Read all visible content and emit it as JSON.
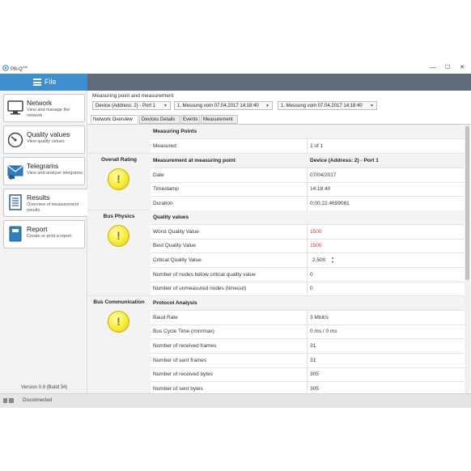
{
  "app": {
    "title": "PB-Q",
    "title_sup": "one"
  },
  "window_controls": {
    "minimize": "—",
    "maximize": "☐",
    "close": "✕"
  },
  "file_menu": {
    "label": "File"
  },
  "nav": [
    {
      "title": "Network",
      "desc": "View and manage the network",
      "icon": "network-monitor-icon"
    },
    {
      "title": "Quality values",
      "desc": "View quality values",
      "icon": "gauge-icon"
    },
    {
      "title": "Telegrams",
      "desc": "View and analyse telegrams",
      "icon": "envelope-icon"
    },
    {
      "title": "Results",
      "desc": "Overview of measurement results",
      "icon": "document-list-icon"
    },
    {
      "title": "Report",
      "desc": "Create or print a report",
      "icon": "report-book-icon"
    }
  ],
  "version": "Version 0.9 (Build 34)",
  "measuring": {
    "label": "Measuring point and measurement",
    "device_select": "Device (Address: 2) - Port 1",
    "measurement_select_1": "1. Messung vom 07.04.2017 14:18:40",
    "measurement_select_2": "1. Messung vom 07.04.2017 14:18:40"
  },
  "tabs": [
    "Network Overview",
    "Devices Details",
    "Events",
    "Measurement"
  ],
  "sections": {
    "overall_rating": "Overall Rating",
    "bus_physics": "Bus Physics",
    "bus_communication": "Bus Communication"
  },
  "table": {
    "measuring_points": {
      "label": "Measuring Points"
    },
    "measured": {
      "label": "Measured",
      "value": "1 of 1"
    },
    "measurement_at_point": {
      "label": "Measurement at measuring point",
      "value": "Device (Address: 2) - Port 1"
    },
    "date": {
      "label": "Date",
      "value": "07/04/2017"
    },
    "timestamp": {
      "label": "Timestamp",
      "value": "14:18:40"
    },
    "duration": {
      "label": "Duration",
      "value": "0:00:22.4699081"
    },
    "quality_values": {
      "label": "Quality values"
    },
    "worst_quality": {
      "label": "Worst Quality Value",
      "value": "1500"
    },
    "best_quality": {
      "label": "Best Quality Value",
      "value": "1500"
    },
    "critical_quality": {
      "label": "Critical Quality Value",
      "value": "2,500"
    },
    "nodes_below_critical": {
      "label": "Number of nodes below critical quality value",
      "value": "0"
    },
    "unmeasured_nodes": {
      "label": "Number of unmeasured nodes (timeout)",
      "value": "0"
    },
    "protocol_analysis": {
      "label": "Protocol Analysis"
    },
    "baud_rate": {
      "label": "Baud Rate",
      "value": "3 Mbit/s"
    },
    "bus_cycle_time": {
      "label": "Bus Cycle Time (min/max)",
      "value": "0 ms / 0 ms"
    },
    "received_frames": {
      "label": "Number of received frames",
      "value": "31"
    },
    "sent_frames": {
      "label": "Number of sent frames",
      "value": "31"
    },
    "received_bytes": {
      "label": "Number of received bytes",
      "value": "305"
    },
    "sent_bytes": {
      "label": "Number of sent bytes",
      "value": "305"
    }
  },
  "status": {
    "text": "Disconnected"
  },
  "colors": {
    "accent": "#3e8ed0",
    "header": "#5f6b78",
    "warning": "#f7ea3a",
    "value_red": "#d9342b"
  }
}
